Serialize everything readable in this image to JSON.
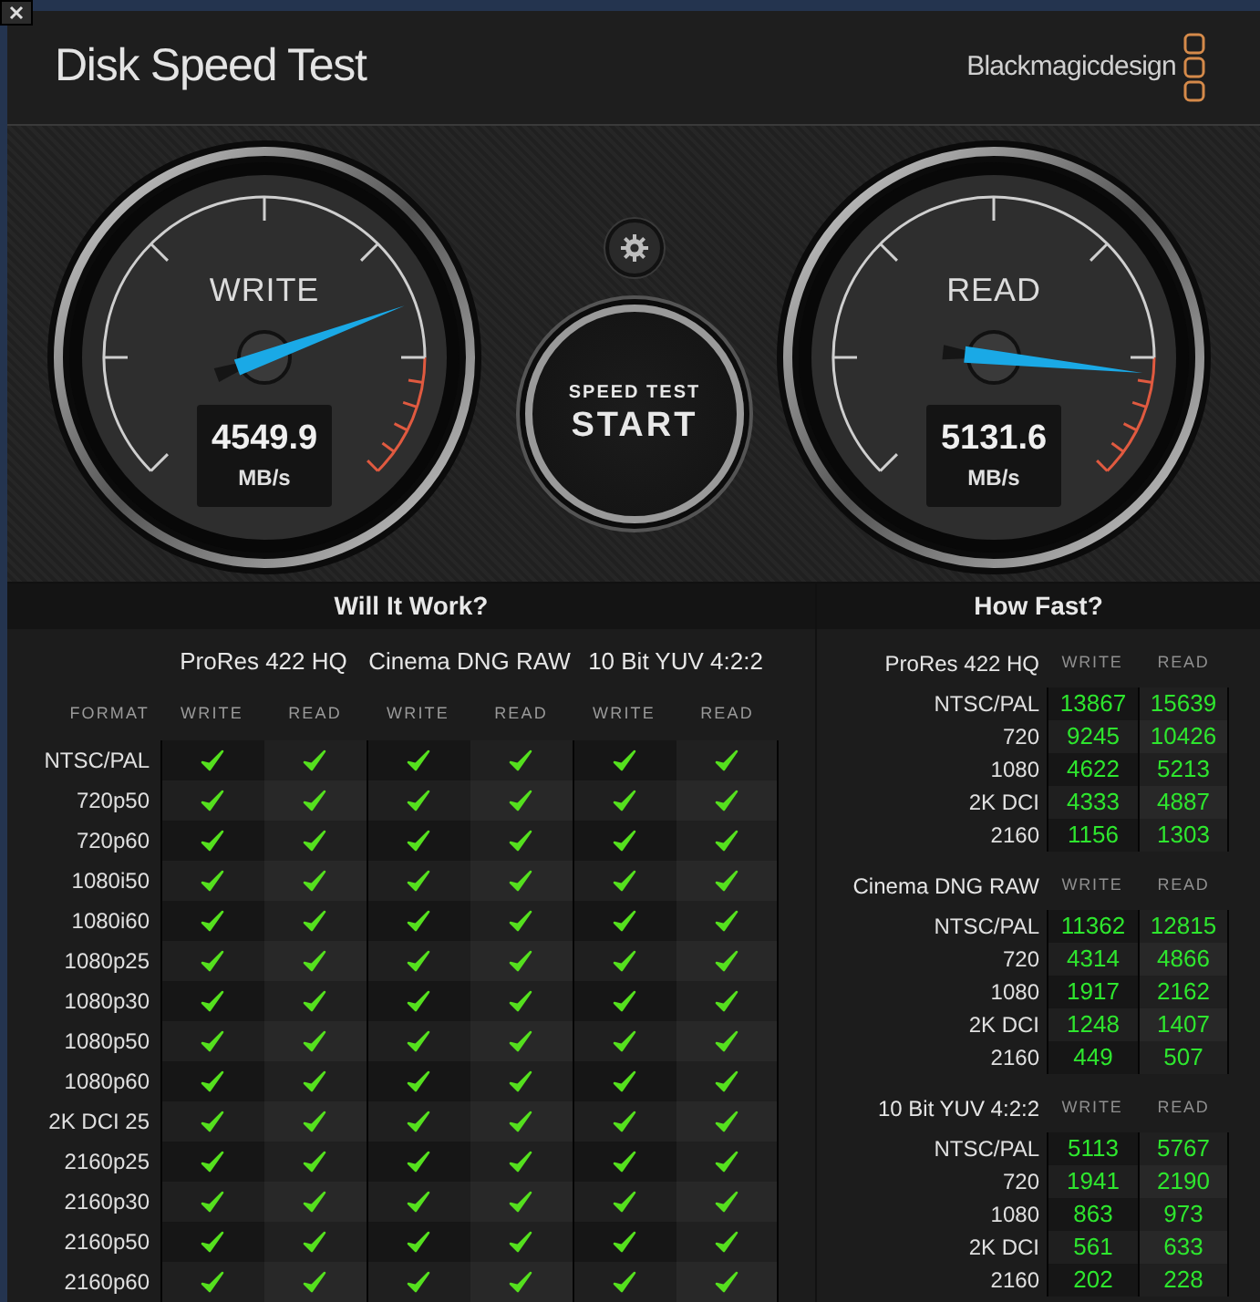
{
  "window": {
    "title": "Disk Speed Test",
    "brand": "Blackmagicdesign"
  },
  "gauges": [
    {
      "label": "WRITE",
      "value": "4549.9",
      "unit": "MB/s"
    },
    {
      "label": "READ",
      "value": "5131.6",
      "unit": "MB/s"
    }
  ],
  "start_button": {
    "caption": "SPEED TEST",
    "label": "START"
  },
  "will_it_work": {
    "title": "Will It Work?",
    "format_header": "FORMAT",
    "codecs": [
      {
        "name": "ProRes 422 HQ",
        "columns": [
          "WRITE",
          "READ"
        ]
      },
      {
        "name": "Cinema DNG RAW",
        "columns": [
          "WRITE",
          "READ"
        ]
      },
      {
        "name": "10 Bit YUV 4:2:2",
        "columns": [
          "WRITE",
          "READ"
        ]
      }
    ],
    "rows": [
      {
        "format": "NTSC/PAL",
        "ok": [
          true,
          true,
          true,
          true,
          true,
          true
        ]
      },
      {
        "format": "720p50",
        "ok": [
          true,
          true,
          true,
          true,
          true,
          true
        ]
      },
      {
        "format": "720p60",
        "ok": [
          true,
          true,
          true,
          true,
          true,
          true
        ]
      },
      {
        "format": "1080i50",
        "ok": [
          true,
          true,
          true,
          true,
          true,
          true
        ]
      },
      {
        "format": "1080i60",
        "ok": [
          true,
          true,
          true,
          true,
          true,
          true
        ]
      },
      {
        "format": "1080p25",
        "ok": [
          true,
          true,
          true,
          true,
          true,
          true
        ]
      },
      {
        "format": "1080p30",
        "ok": [
          true,
          true,
          true,
          true,
          true,
          true
        ]
      },
      {
        "format": "1080p50",
        "ok": [
          true,
          true,
          true,
          true,
          true,
          true
        ]
      },
      {
        "format": "1080p60",
        "ok": [
          true,
          true,
          true,
          true,
          true,
          true
        ]
      },
      {
        "format": "2K DCI 25",
        "ok": [
          true,
          true,
          true,
          true,
          true,
          true
        ]
      },
      {
        "format": "2160p25",
        "ok": [
          true,
          true,
          true,
          true,
          true,
          true
        ]
      },
      {
        "format": "2160p30",
        "ok": [
          true,
          true,
          true,
          true,
          true,
          true
        ]
      },
      {
        "format": "2160p50",
        "ok": [
          true,
          true,
          true,
          true,
          true,
          true
        ]
      },
      {
        "format": "2160p60",
        "ok": [
          true,
          true,
          true,
          true,
          true,
          true
        ]
      }
    ]
  },
  "how_fast": {
    "title": "How Fast?",
    "sections": [
      {
        "codec": "ProRes 422 HQ",
        "columns": [
          "WRITE",
          "READ"
        ],
        "rows": [
          {
            "format": "NTSC/PAL",
            "write": "13867",
            "read": "15639"
          },
          {
            "format": "720",
            "write": "9245",
            "read": "10426"
          },
          {
            "format": "1080",
            "write": "4622",
            "read": "5213"
          },
          {
            "format": "2K DCI",
            "write": "4333",
            "read": "4887"
          },
          {
            "format": "2160",
            "write": "1156",
            "read": "1303"
          }
        ]
      },
      {
        "codec": "Cinema DNG RAW",
        "columns": [
          "WRITE",
          "READ"
        ],
        "rows": [
          {
            "format": "NTSC/PAL",
            "write": "11362",
            "read": "12815"
          },
          {
            "format": "720",
            "write": "4314",
            "read": "4866"
          },
          {
            "format": "1080",
            "write": "1917",
            "read": "2162"
          },
          {
            "format": "2K DCI",
            "write": "1248",
            "read": "1407"
          },
          {
            "format": "2160",
            "write": "449",
            "read": "507"
          }
        ]
      },
      {
        "codec": "10 Bit YUV 4:2:2",
        "columns": [
          "WRITE",
          "READ"
        ],
        "rows": [
          {
            "format": "NTSC/PAL",
            "write": "5113",
            "read": "5767"
          },
          {
            "format": "720",
            "write": "1941",
            "read": "2190"
          },
          {
            "format": "1080",
            "write": "863",
            "read": "973"
          },
          {
            "format": "2K DCI",
            "write": "561",
            "read": "633"
          },
          {
            "format": "2160",
            "write": "202",
            "read": "228"
          }
        ]
      }
    ]
  }
}
